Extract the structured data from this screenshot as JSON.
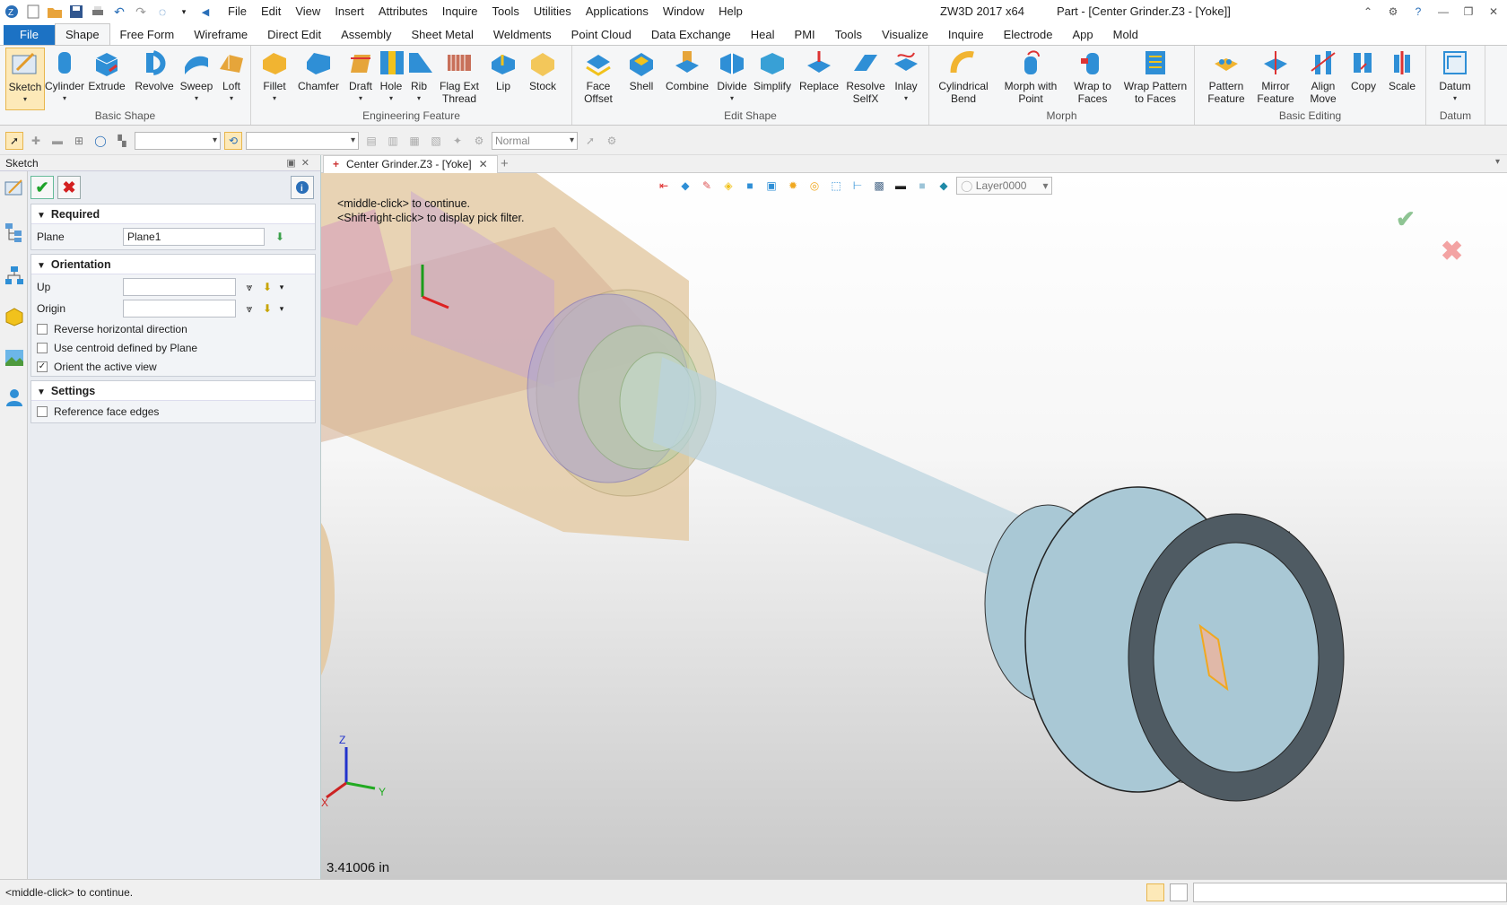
{
  "app": {
    "title": "ZW3D 2017  x64",
    "document_title": "Part - [Center Grinder.Z3 - [Yoke]]"
  },
  "menubar": [
    "File",
    "Edit",
    "View",
    "Insert",
    "Attributes",
    "Inquire",
    "Tools",
    "Utilities",
    "Applications",
    "Window",
    "Help"
  ],
  "ribbon_tabs": [
    "File",
    "Shape",
    "Free Form",
    "Wireframe",
    "Direct Edit",
    "Assembly",
    "Sheet Metal",
    "Weldments",
    "Point Cloud",
    "Data Exchange",
    "Heal",
    "PMI",
    "Tools",
    "Visualize",
    "Inquire",
    "Electrode",
    "App",
    "Mold"
  ],
  "active_tab": "Shape",
  "ribbon_groups": [
    {
      "label": "Basic Shape",
      "buttons": [
        "Sketch",
        "Cylinder",
        "Extrude",
        "Revolve",
        "Sweep",
        "Loft"
      ]
    },
    {
      "label": "Engineering Feature",
      "buttons": [
        "Fillet",
        "Chamfer",
        "Draft",
        "Hole",
        "Rib",
        "Flag Ext Thread",
        "Lip",
        "Stock"
      ]
    },
    {
      "label": "Edit Shape",
      "buttons": [
        "Face Offset",
        "Shell",
        "Combine",
        "Divide",
        "Simplify",
        "Replace",
        "Resolve SelfX",
        "Inlay"
      ]
    },
    {
      "label": "Morph",
      "buttons": [
        "Cylindrical Bend",
        "Morph with Point",
        "Wrap to Faces",
        "Wrap Pattern to Faces"
      ]
    },
    {
      "label": "Basic Editing",
      "buttons": [
        "Pattern Feature",
        "Mirror Feature",
        "Align Move",
        "Copy",
        "Scale"
      ]
    },
    {
      "label": "Datum",
      "buttons": [
        "Datum"
      ]
    }
  ],
  "toolbar2": {
    "render_mode": "Normal"
  },
  "panel": {
    "title": "Sketch",
    "sections": {
      "required": {
        "label": "Required",
        "plane_label": "Plane",
        "plane_value": "Plane1"
      },
      "orientation": {
        "label": "Orientation",
        "up_label": "Up",
        "up_value": "",
        "origin_label": "Origin",
        "origin_value": "",
        "checks": [
          {
            "label": "Reverse horizontal direction",
            "checked": false
          },
          {
            "label": "Use centroid defined by Plane",
            "checked": false
          },
          {
            "label": "Orient the active view",
            "checked": true
          }
        ]
      },
      "settings": {
        "label": "Settings",
        "checks": [
          {
            "label": "Reference face edges",
            "checked": false
          }
        ]
      }
    }
  },
  "doc_tab": {
    "label": "Center Grinder.Z3 - [Yoke]"
  },
  "viewport": {
    "hint_line1": "<middle-click> to continue.",
    "hint_line2": "<Shift-right-click> to display pick filter.",
    "layer": "Layer0000",
    "measurement": "3.41006 in",
    "axis_x": "X",
    "axis_y": "Y",
    "axis_z": "Z"
  },
  "status": {
    "text": "<middle-click> to continue."
  },
  "colors": {
    "accent": "#1c72c4",
    "part_blue": "#a9c8d5",
    "part_tan": "#e2c9a8",
    "part_dark": "#4f5b63"
  }
}
